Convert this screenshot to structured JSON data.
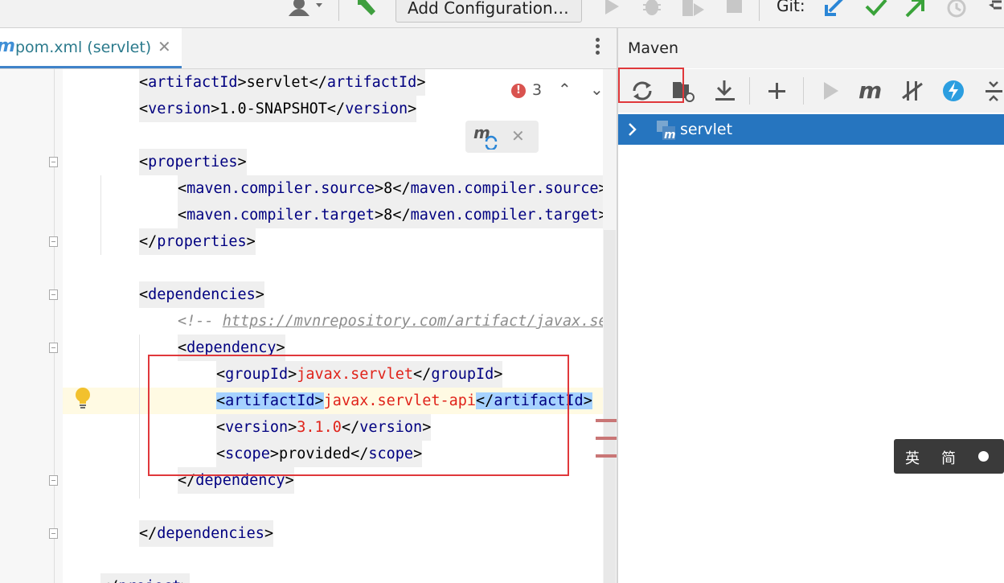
{
  "toolbar": {
    "add_configuration": "Add Configuration…",
    "git_label": "Git:",
    "icons": [
      "user-icon",
      "build-hammer-icon",
      "run-icon",
      "debug-icon",
      "coverage-icon",
      "stop-icon",
      "git-update-icon",
      "git-commit-icon",
      "git-push-icon",
      "history-icon",
      "rollback-icon"
    ]
  },
  "editor": {
    "tab": {
      "label": "pom.xml (servlet)",
      "icon": "maven-file-icon"
    },
    "inspection": {
      "error_count": "3"
    },
    "lines": [
      [
        {
          "t": "<",
          "c": "tok"
        },
        {
          "t": "artifactId",
          "c": "tag"
        },
        {
          "t": ">servlet</",
          "c": "tok"
        },
        {
          "t": "artifactId",
          "c": "tag"
        },
        {
          "t": ">",
          "c": "tok"
        }
      ],
      [
        {
          "t": "<",
          "c": "tok"
        },
        {
          "t": "version",
          "c": "tag"
        },
        {
          "t": ">1.0-SNAPSHOT</",
          "c": "tok"
        },
        {
          "t": "version",
          "c": "tag"
        },
        {
          "t": ">",
          "c": "tok"
        }
      ],
      [],
      [
        {
          "t": "<",
          "c": "tok"
        },
        {
          "t": "properties",
          "c": "tag"
        },
        {
          "t": ">",
          "c": "tok"
        }
      ],
      [
        {
          "t": "<",
          "c": "tok"
        },
        {
          "t": "maven.compiler.source",
          "c": "tag"
        },
        {
          "t": ">8</",
          "c": "tok"
        },
        {
          "t": "maven.compiler.source",
          "c": "tag"
        },
        {
          "t": ">",
          "c": "tok"
        }
      ],
      [
        {
          "t": "<",
          "c": "tok"
        },
        {
          "t": "maven.compiler.target",
          "c": "tag"
        },
        {
          "t": ">8</",
          "c": "tok"
        },
        {
          "t": "maven.compiler.target",
          "c": "tag"
        },
        {
          "t": ">",
          "c": "tok"
        }
      ],
      [
        {
          "t": "</",
          "c": "tok"
        },
        {
          "t": "properties",
          "c": "tag"
        },
        {
          "t": ">",
          "c": "tok"
        }
      ],
      [],
      [
        {
          "t": "<",
          "c": "tok"
        },
        {
          "t": "dependencies",
          "c": "tag"
        },
        {
          "t": ">",
          "c": "tok"
        }
      ],
      [
        {
          "t": "<!-- ",
          "c": "cmt"
        },
        {
          "t": "https://mvnrepository.com/artifact/javax.servlet/javax.servlet-api",
          "c": "cmt-link"
        }
      ],
      [
        {
          "t": "<",
          "c": "tok"
        },
        {
          "t": "dependency",
          "c": "tag"
        },
        {
          "t": ">",
          "c": "tok"
        }
      ],
      [
        {
          "t": "<",
          "c": "tok"
        },
        {
          "t": "groupId",
          "c": "tag"
        },
        {
          "t": ">",
          "c": "tok"
        },
        {
          "t": "javax.servlet",
          "c": "tval"
        },
        {
          "t": "</",
          "c": "tok"
        },
        {
          "t": "groupId",
          "c": "tag"
        },
        {
          "t": ">",
          "c": "tok"
        }
      ],
      [
        {
          "t": "<",
          "c": "tok sel"
        },
        {
          "t": "artifactId",
          "c": "tag sel"
        },
        {
          "t": ">",
          "c": "tok sel"
        },
        {
          "t": "javax.servlet-api",
          "c": "tval"
        },
        {
          "t": "</",
          "c": "tok sel"
        },
        {
          "t": "artifactId",
          "c": "tag sel"
        },
        {
          "t": ">",
          "c": "tok sel"
        }
      ],
      [
        {
          "t": "<",
          "c": "tok"
        },
        {
          "t": "version",
          "c": "tag"
        },
        {
          "t": ">",
          "c": "tok"
        },
        {
          "t": "3.1.0",
          "c": "tval"
        },
        {
          "t": "</",
          "c": "tok"
        },
        {
          "t": "version",
          "c": "tag"
        },
        {
          "t": ">",
          "c": "tok"
        }
      ],
      [
        {
          "t": "<",
          "c": "tok"
        },
        {
          "t": "scope",
          "c": "tag"
        },
        {
          "t": ">provided</",
          "c": "tok"
        },
        {
          "t": "scope",
          "c": "tag"
        },
        {
          "t": ">",
          "c": "tok"
        }
      ],
      [
        {
          "t": "</",
          "c": "tok"
        },
        {
          "t": "dependency",
          "c": "tag"
        },
        {
          "t": ">",
          "c": "tok"
        }
      ],
      [],
      [
        {
          "t": "</",
          "c": "tok"
        },
        {
          "t": "dependencies",
          "c": "tag"
        },
        {
          "t": ">",
          "c": "tok"
        }
      ],
      [],
      [
        {
          "t": "</",
          "c": "tok"
        },
        {
          "t": "project",
          "c": "tag"
        },
        {
          "t": ">",
          "c": "tok"
        }
      ]
    ],
    "indents": [
      1,
      1,
      0,
      1,
      2,
      2,
      1,
      0,
      1,
      2,
      2,
      3,
      3,
      3,
      3,
      2,
      0,
      1,
      0,
      0
    ],
    "highlight_line": 12,
    "tagbg_lines": [
      0,
      1,
      3,
      4,
      5,
      6,
      8,
      10,
      11,
      13,
      14,
      15,
      17,
      19
    ]
  },
  "maven": {
    "title": "Maven",
    "toolbar_icons": [
      "reload-all-icon",
      "generate-sources-icon",
      "download-icon",
      "add-project-icon",
      "run-goal-icon",
      "execute-goal-icon",
      "toggle-offline-icon",
      "skip-tests-icon",
      "collapse-all-icon"
    ],
    "tree": [
      {
        "label": "servlet",
        "expanded": false
      }
    ]
  },
  "ime": {
    "mode_a": "英",
    "mode_b": "简"
  },
  "colors": {
    "accent": "#2675bf",
    "tag": "#000080",
    "value": "#e0231a",
    "highlight_box": "#e0383b"
  }
}
